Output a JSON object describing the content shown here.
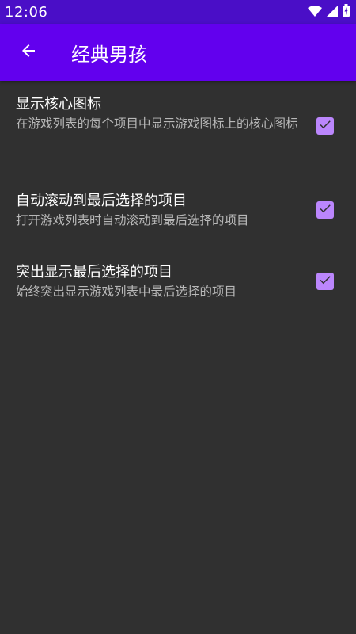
{
  "status_bar": {
    "time": "12:06",
    "icons": [
      "wifi-icon",
      "signal-icon",
      "battery-icon"
    ]
  },
  "app_bar": {
    "back_icon": "arrow-left-icon",
    "title": "经典男孩"
  },
  "preferences": [
    {
      "title": "显示核心图标",
      "summary": "在游戏列表的每个项目中显示游戏图标上的核心图标",
      "checked": true
    },
    {
      "title": "自动滚动到最后选择的项目",
      "summary": "打开游戏列表时自动滚动到最后选择的项目",
      "checked": true
    },
    {
      "title": "突出显示最后选择的项目",
      "summary": "始终突出显示游戏列表中最后选择的项目",
      "checked": true
    }
  ],
  "colors": {
    "status_bar": "#4a0ec7",
    "app_bar": "#6200ee",
    "background": "#303030",
    "checkbox_accent": "#bb86fc"
  }
}
